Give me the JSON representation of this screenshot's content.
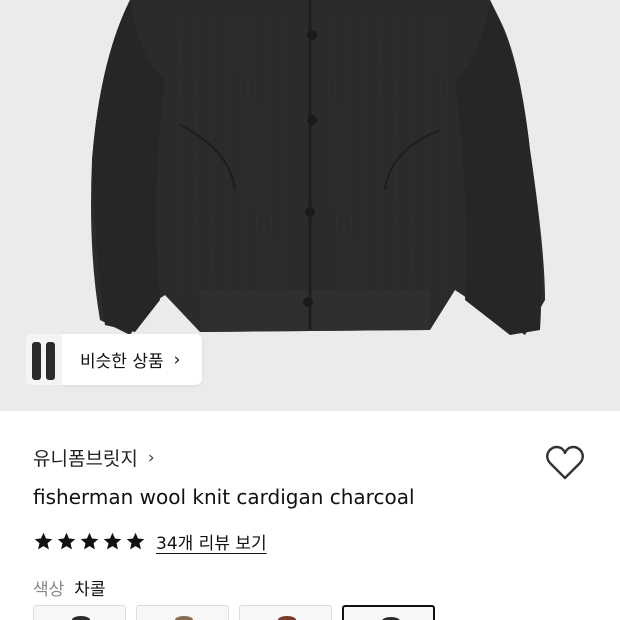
{
  "product": {
    "similar_label": "비슷한 상품",
    "brand": "유니폼브릿지",
    "title": "fisherman wool knit cardigan charcoal",
    "rating_stars": 5,
    "review_link": "34개 리뷰 보기",
    "color_label": "색상",
    "color_value": "차콜",
    "swatch_colors": [
      "#2b2b2b",
      "#8a6c52",
      "#7a3a2a",
      "#2b2b2b"
    ],
    "selected_swatch": 3,
    "icons": {
      "similar_chevron": "chevron-right-icon",
      "brand_chevron": "chevron-right-icon",
      "wishlist": "heart-outline-icon",
      "star": "star-filled-icon"
    }
  }
}
